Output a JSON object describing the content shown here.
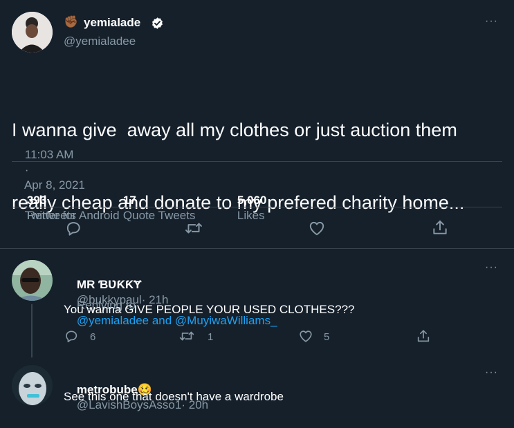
{
  "main_tweet": {
    "author": {
      "emoji": "✊🏾",
      "name": "yemialade",
      "handle": "@yemialadee"
    },
    "text_lines": [
      "I wanna give  away all my clothes or just auction them",
      "really cheap and donate to my prefered charity home..."
    ],
    "time": "11:03 AM",
    "date": "Apr 8, 2021",
    "source": "Twitter for Android",
    "separator": "·",
    "stats": {
      "retweets_count": "393",
      "retweets_label": "Retweets",
      "quotes_count": "17",
      "quotes_label": "Quote Tweets",
      "likes_count": "5,060",
      "likes_label": "Likes"
    },
    "actions": [
      "reply-icon",
      "retweet-icon",
      "like-icon",
      "share-icon"
    ]
  },
  "replies": [
    {
      "name": "MR ƁƲƘƘɎ",
      "handle": "@bukkypaul",
      "time": "· 21h",
      "replying_prefix": "Replying to",
      "replying_users": "@yemialadee and @MuyiwaWilliams_",
      "text": "You wanna GIVE PEOPLE YOUR USED CLOTHES???",
      "reply_count": "6",
      "retweet_count": "1",
      "like_count": "5"
    },
    {
      "name": "metrobube",
      "emoji": "🥴",
      "handle": "@LavishBoysAsso1",
      "time": "· 20h",
      "text": "See this one that doesn't have a wardrobe"
    }
  ],
  "more_label": "···",
  "colors": {
    "background": "#15202b",
    "text": "#ffffff",
    "muted": "#8899a6",
    "accent": "#1da1f2",
    "divider": "#38444d"
  }
}
